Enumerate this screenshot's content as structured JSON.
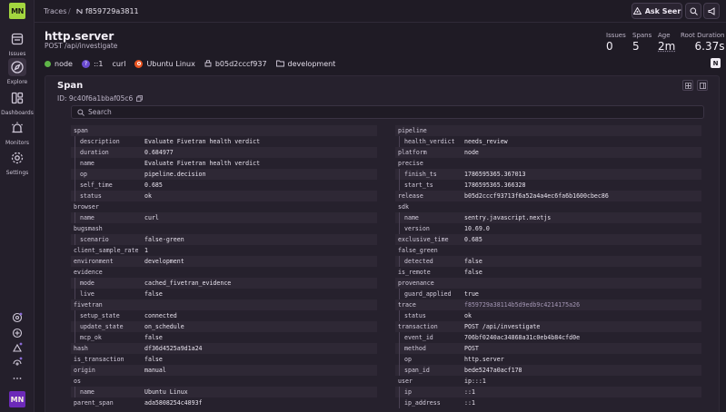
{
  "sidebar": {
    "logo": "MN",
    "items": [
      {
        "label": "Issues",
        "icon": "issues-icon"
      },
      {
        "label": "Explore",
        "icon": "compass-icon",
        "active": true
      },
      {
        "label": "Dashboards",
        "icon": "dashboard-icon"
      },
      {
        "label": "Monitors",
        "icon": "siren-icon"
      },
      {
        "label": "Settings",
        "icon": "gear-icon"
      }
    ],
    "avatar": "MN"
  },
  "breadcrumb": {
    "root": "Traces",
    "separator": "/",
    "trace_id": "f859729a3811"
  },
  "toolbar": {
    "seer_label": "Ask Seer"
  },
  "header": {
    "title": "http.server",
    "subtitle": "POST /api/investigate",
    "stats": [
      {
        "label": "Issues",
        "value": "0"
      },
      {
        "label": "Spans",
        "value": "5"
      },
      {
        "label": "Age",
        "value": "2m"
      },
      {
        "label": "Root Duration",
        "value": "6.37s"
      }
    ],
    "tags": {
      "runtime": "node",
      "ip": "::1",
      "client": "curl",
      "os": "Ubuntu Linux",
      "release": "b05d2cccf937",
      "environment": "development"
    }
  },
  "panel": {
    "title": "Span",
    "id_label": "ID: 9c40f6a1bbaf05c6",
    "search_placeholder": "Search"
  },
  "attributes_left": [
    {
      "k": "span",
      "v": "",
      "d": 0
    },
    {
      "k": "description",
      "v": "Evaluate Fivetran health verdict",
      "d": 1
    },
    {
      "k": "duration",
      "v": "0.684977",
      "d": 1
    },
    {
      "k": "name",
      "v": "Evaluate Fivetran health verdict",
      "d": 1
    },
    {
      "k": "op",
      "v": "pipeline.decision",
      "d": 1
    },
    {
      "k": "self_time",
      "v": "0.685",
      "d": 1
    },
    {
      "k": "status",
      "v": "ok",
      "d": 1
    },
    {
      "k": "browser",
      "v": "",
      "d": 0
    },
    {
      "k": "name",
      "v": "curl",
      "d": 1
    },
    {
      "k": "bugsmash",
      "v": "",
      "d": 0
    },
    {
      "k": "scenario",
      "v": "false-green",
      "d": 1
    },
    {
      "k": "client_sample_rate",
      "v": "1",
      "d": 0
    },
    {
      "k": "environment",
      "v": "development",
      "d": 0
    },
    {
      "k": "evidence",
      "v": "",
      "d": 0
    },
    {
      "k": "mode",
      "v": "cached_fivetran_evidence",
      "d": 1
    },
    {
      "k": "live",
      "v": "false",
      "d": 1
    },
    {
      "k": "fivetran",
      "v": "",
      "d": 0
    },
    {
      "k": "setup_state",
      "v": "connected",
      "d": 1
    },
    {
      "k": "update_state",
      "v": "on_schedule",
      "d": 1
    },
    {
      "k": "mcp_ok",
      "v": "false",
      "d": 1
    },
    {
      "k": "hash",
      "v": "df36d4525a9d1a24",
      "d": 0
    },
    {
      "k": "is_transaction",
      "v": "false",
      "d": 0
    },
    {
      "k": "origin",
      "v": "manual",
      "d": 0
    },
    {
      "k": "os",
      "v": "",
      "d": 0
    },
    {
      "k": "name",
      "v": "Ubuntu Linux",
      "d": 1
    },
    {
      "k": "parent_span",
      "v": "ada5808254c4893f",
      "d": 0
    }
  ],
  "attributes_right": [
    {
      "k": "pipeline",
      "v": "",
      "d": 0
    },
    {
      "k": "health_verdict",
      "v": "needs_review",
      "d": 1
    },
    {
      "k": "platform",
      "v": "node",
      "d": 0
    },
    {
      "k": "precise",
      "v": "",
      "d": 0
    },
    {
      "k": "finish_ts",
      "v": "1786595365.367013",
      "d": 1
    },
    {
      "k": "start_ts",
      "v": "1786595365.366328",
      "d": 1
    },
    {
      "k": "release",
      "v": "b05d2cccf93713f6a52a4a4ec6fa6b1600cbec86",
      "d": 0
    },
    {
      "k": "sdk",
      "v": "",
      "d": 0
    },
    {
      "k": "name",
      "v": "sentry.javascript.nextjs",
      "d": 1
    },
    {
      "k": "version",
      "v": "10.69.0",
      "d": 1
    },
    {
      "k": "exclusive_time",
      "v": "0.685",
      "d": 0
    },
    {
      "k": "false_green",
      "v": "",
      "d": 0
    },
    {
      "k": "detected",
      "v": "false",
      "d": 1
    },
    {
      "k": "is_remote",
      "v": "false",
      "d": 0
    },
    {
      "k": "provenance",
      "v": "",
      "d": 0
    },
    {
      "k": "guard_applied",
      "v": "true",
      "d": 1
    },
    {
      "k": "trace",
      "v": "f859729a38114b5d9edb9c4214175a26",
      "d": 0,
      "link": true
    },
    {
      "k": "status",
      "v": "ok",
      "d": 1
    },
    {
      "k": "transaction",
      "v": "POST /api/investigate",
      "d": 0
    },
    {
      "k": "event_id",
      "v": "706bf0240ac34868a31c0eb4b84cfd0e",
      "d": 1
    },
    {
      "k": "method",
      "v": "POST",
      "d": 1
    },
    {
      "k": "op",
      "v": "http.server",
      "d": 1
    },
    {
      "k": "span_id",
      "v": "bede5247a0acf178",
      "d": 1
    },
    {
      "k": "user",
      "v": "ip:::1",
      "d": 0
    },
    {
      "k": "ip",
      "v": "::1",
      "d": 1
    },
    {
      "k": "ip_address",
      "v": "::1",
      "d": 1
    }
  ],
  "colors": {
    "background": "#1f1b25",
    "logo": "#a3d63f",
    "avatar": "#6c2ab8",
    "node_dot": "#5fb548"
  }
}
